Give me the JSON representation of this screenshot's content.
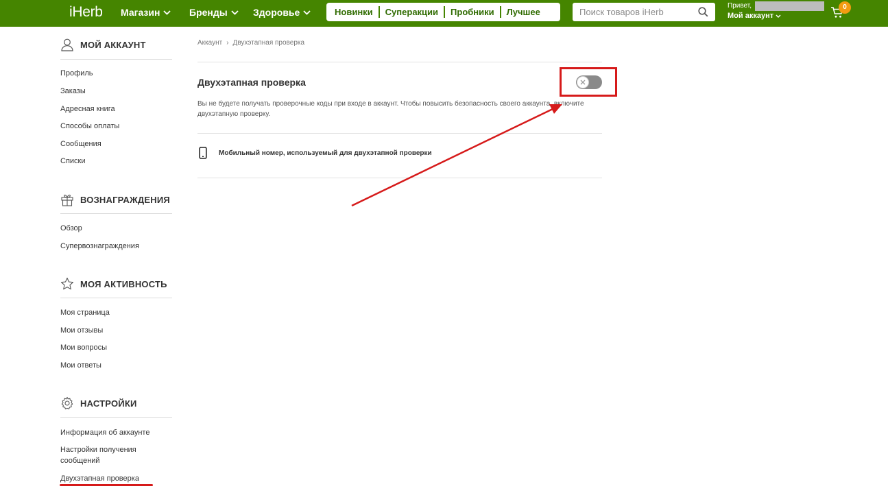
{
  "header": {
    "logo": "iHerb",
    "nav": [
      "Магазин",
      "Бренды",
      "Здоровье"
    ],
    "promo_links": [
      "Новинки",
      "Суперакции",
      "Пробники",
      "Лучшее"
    ],
    "search_placeholder": "Поиск товаров iHerb",
    "greeting": "Привет,",
    "account_label": "Мой аккаунт",
    "cart_count": "0",
    "brand_color": "#458500",
    "badge_color": "#f39c12"
  },
  "sidebar": {
    "account": {
      "title": "МОЙ АККАУНТ",
      "icon": "user-icon",
      "items": [
        "Профиль",
        "Заказы",
        "Адресная книга",
        "Способы оплаты",
        "Сообщения",
        "Списки"
      ]
    },
    "rewards": {
      "title": "ВОЗНАГРАЖДЕНИЯ",
      "icon": "gift-icon",
      "items": [
        "Обзор",
        "Супервознаграждения"
      ]
    },
    "activity": {
      "title": "МОЯ АКТИВНОСТЬ",
      "icon": "star-icon",
      "items": [
        "Моя страница",
        "Мои отзывы",
        "Мои вопросы",
        "Мои ответы"
      ]
    },
    "settings": {
      "title": "НАСТРОЙКИ",
      "icon": "gear-icon",
      "items": [
        "Информация об аккаунте",
        "Настройки получения сообщений",
        "Двухэтапная проверка"
      ]
    }
  },
  "main": {
    "breadcrumb": [
      "Аккаунт",
      "›",
      "Двухэтапная проверка"
    ],
    "heading": "Двухэтапная проверка",
    "toggle_on": false,
    "description": "Вы не будете получать проверочные коды при входе в аккаунт. Чтобы повысить безопасность своего аккаунта, включите двухэтапную проверку.",
    "phone_label": "Мобильный номер, используемый для двухэтапной проверки"
  },
  "annotations": {
    "color": "#d61a1a"
  }
}
